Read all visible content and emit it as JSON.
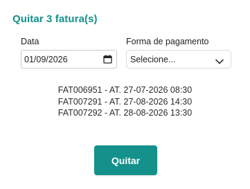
{
  "dialog": {
    "title": "Quitar 3 fatura(s)",
    "date_field": {
      "label": "Data",
      "value": "01/09/2026",
      "icon": "calendar-icon"
    },
    "payment_field": {
      "label": "Forma de pagamento",
      "selected": "Selecione...",
      "icon": "chevron-down-icon"
    },
    "invoices": [
      "FAT006951 - AT. 27-07-2026 08:30",
      "FAT007291 - AT. 27-08-2026 14:30",
      "FAT007292 - AT. 28-08-2026 13:30"
    ],
    "submit_label": "Quitar"
  },
  "colors": {
    "accent": "#13918a",
    "text": "#222222"
  }
}
